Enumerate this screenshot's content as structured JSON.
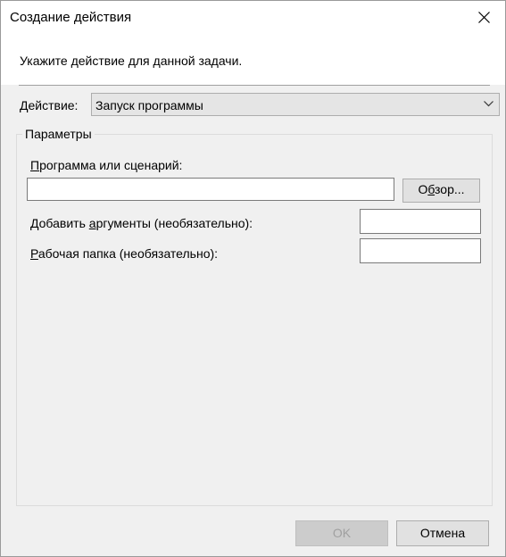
{
  "window": {
    "title": "Создание действия"
  },
  "header": {
    "instruction": "Укажите действие для данной задачи."
  },
  "action": {
    "label": "Действие:",
    "selected": "Запуск программы"
  },
  "params": {
    "group_label": "Параметры",
    "program_label_mnemonic": "П",
    "program_label_rest": "рограмма или сценарий:",
    "program_value": "",
    "browse_mnemonic": "б",
    "browse_pre": "О",
    "browse_post": "зор...",
    "args_label_pre": "Добавить ",
    "args_label_mnemonic": "а",
    "args_label_rest": "ргументы (необязательно):",
    "args_value": "",
    "workdir_label_mnemonic": "Р",
    "workdir_label_rest": "абочая папка (необязательно):",
    "workdir_value": ""
  },
  "footer": {
    "ok_label": "OK",
    "cancel_label": "Отмена"
  },
  "icons": {
    "close": "close-icon",
    "dropdown": "chevron-down-icon"
  }
}
